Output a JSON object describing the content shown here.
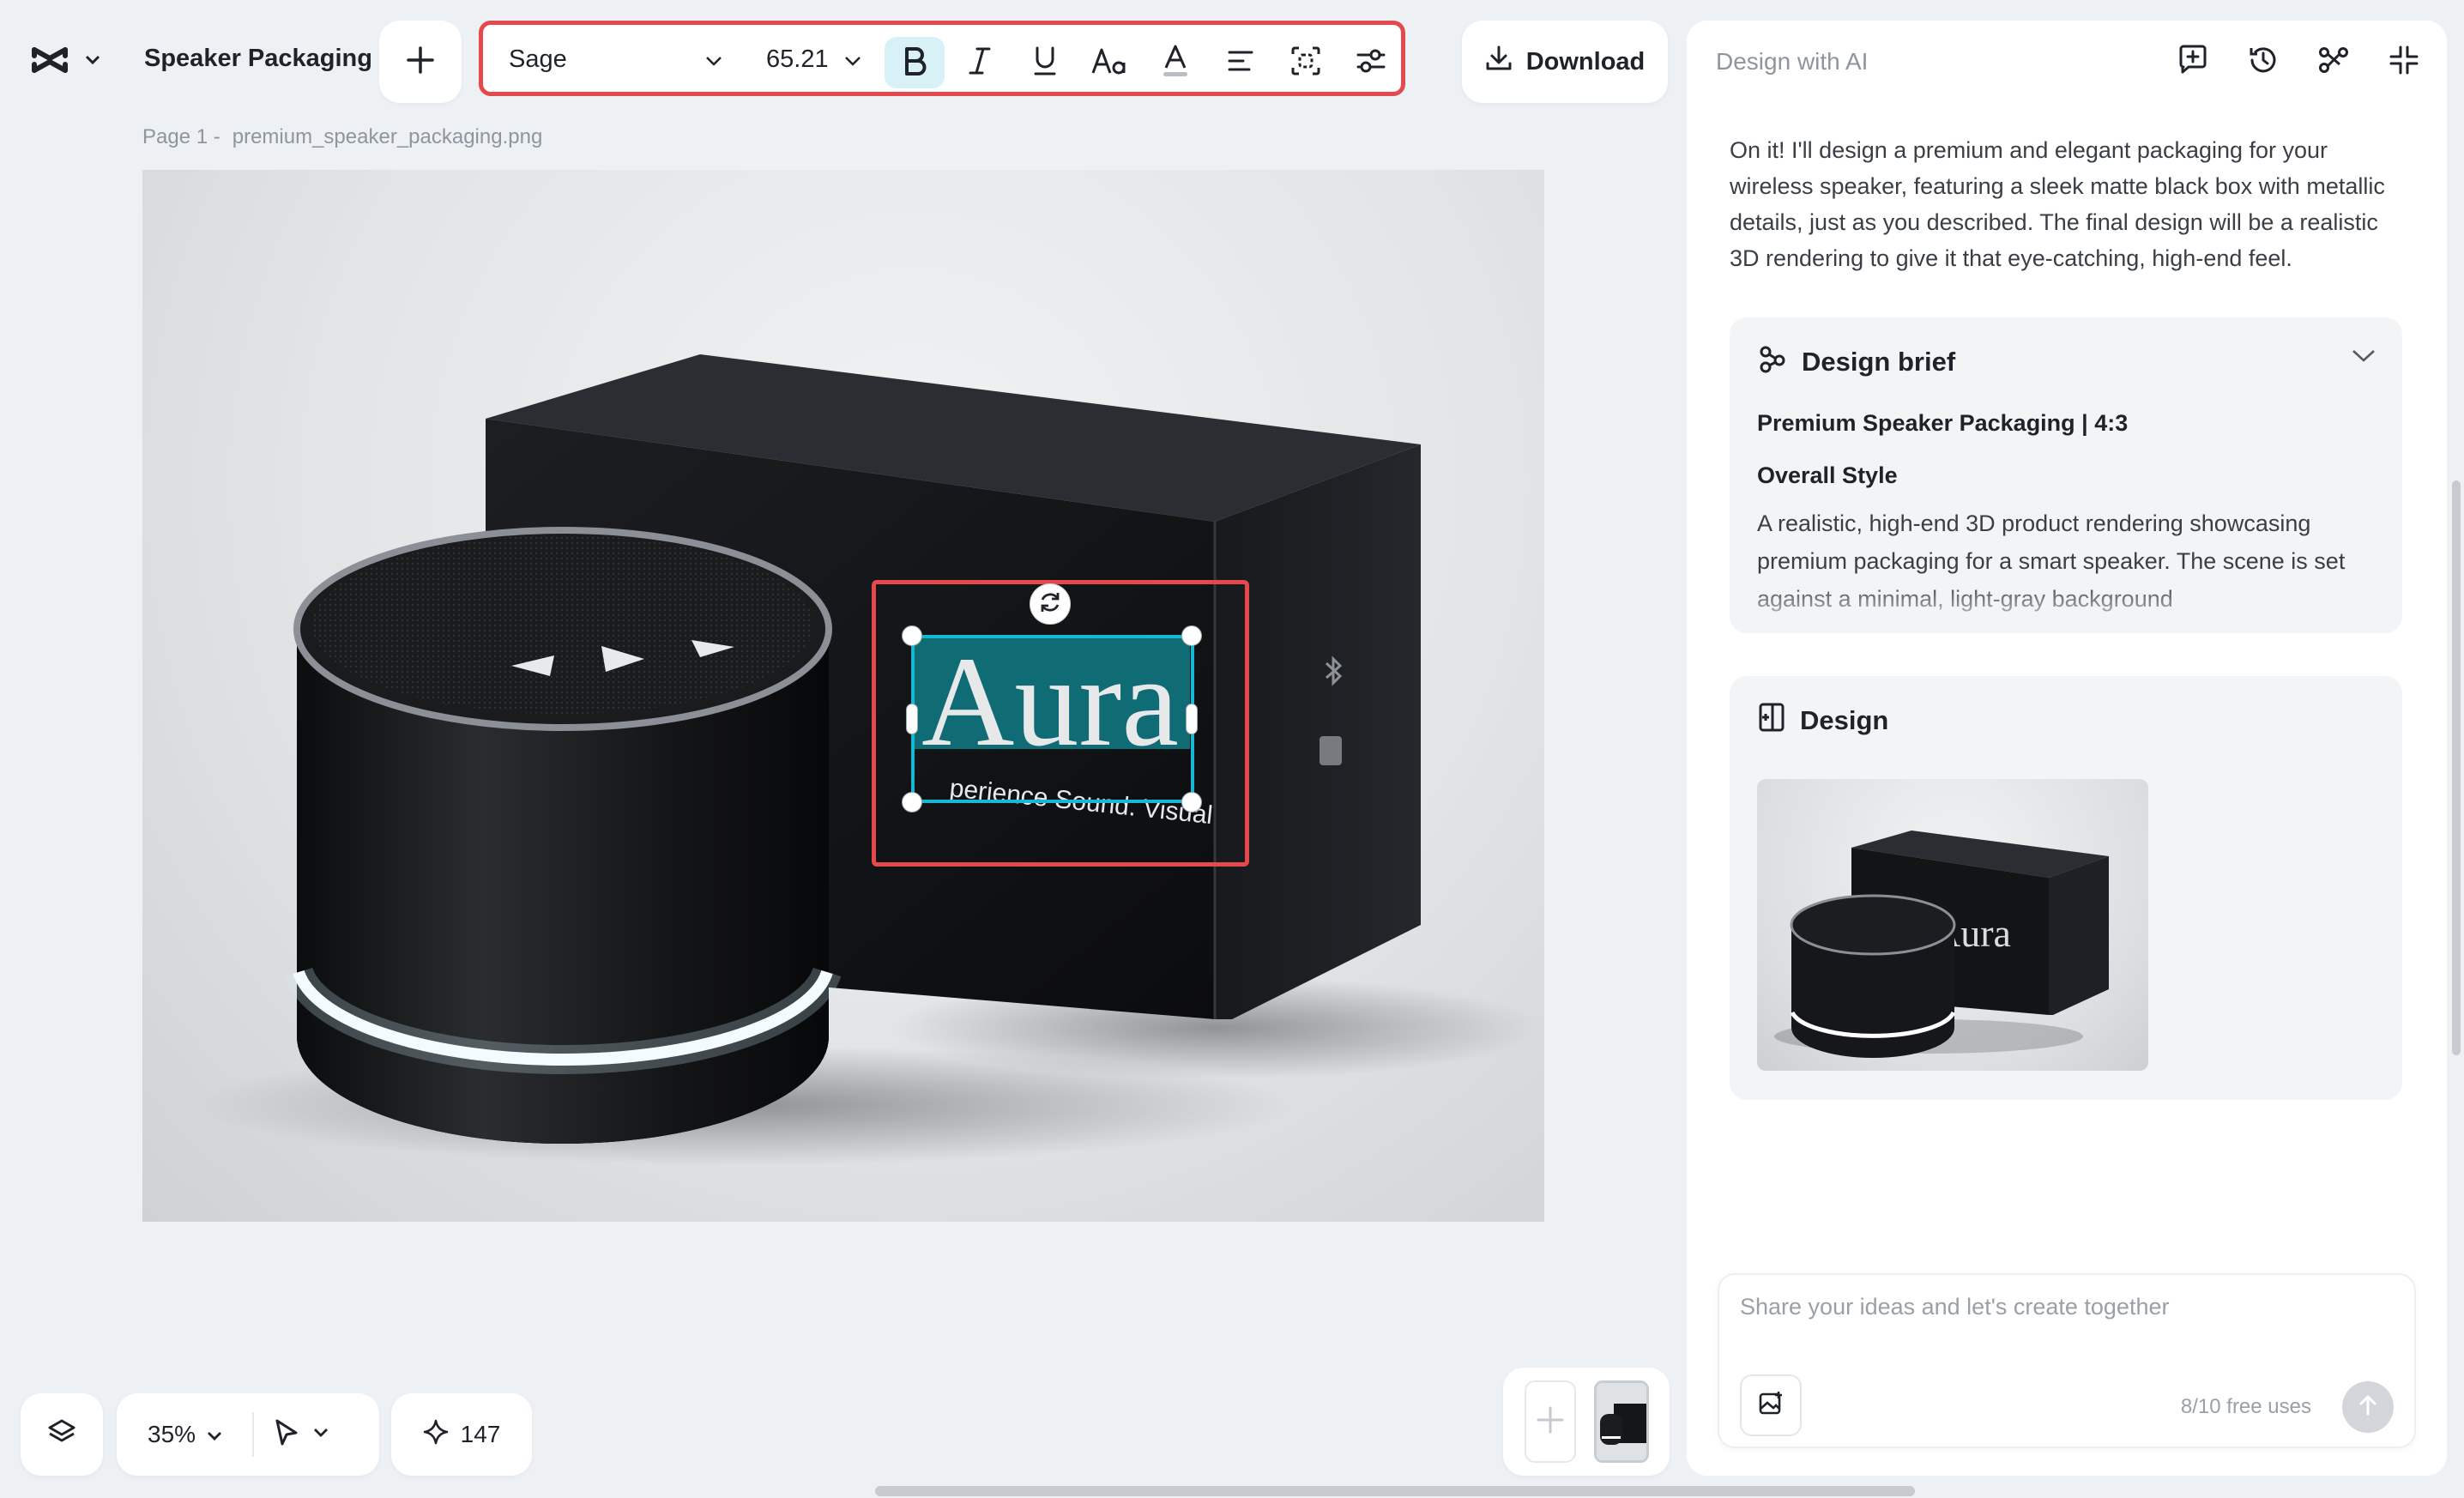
{
  "header": {
    "project_name": "Speaker Packaging",
    "download_label": "Download"
  },
  "toolbar": {
    "font": "Sage",
    "font_size": "65.21",
    "bold_active": true
  },
  "canvas": {
    "page_prefix": "Page 1 -",
    "file_name": "premium_speaker_packaging.png",
    "box_title": "Aura",
    "box_tagline": "perience Sound. Visual"
  },
  "bottom": {
    "zoom": "35%",
    "credits": "147"
  },
  "panel": {
    "title": "Design with AI",
    "message": "On it! I'll design a premium and elegant packaging for your wireless speaker, featuring a sleek matte black box with metallic details, just as you described. The final design will be a realistic 3D rendering to give it that eye-catching, high-end feel.",
    "brief": {
      "title": "Design brief",
      "subtitle": "Premium Speaker Packaging | 4:3",
      "section_heading": "Overall Style",
      "section_text": "A realistic, high-end 3D product rendering showcasing premium packaging for a smart speaker. The scene is set against a minimal, light-gray background"
    },
    "design": {
      "title": "Design",
      "thumb_text": "Aura"
    },
    "chat": {
      "placeholder": "Share your ideas and let's create together",
      "uses": "8/10 free uses"
    }
  },
  "colors": {
    "accent_red": "#e5484d",
    "selection_cyan": "#17b7d6",
    "text_teal": "#0f6b74",
    "box_black": "#121416"
  }
}
